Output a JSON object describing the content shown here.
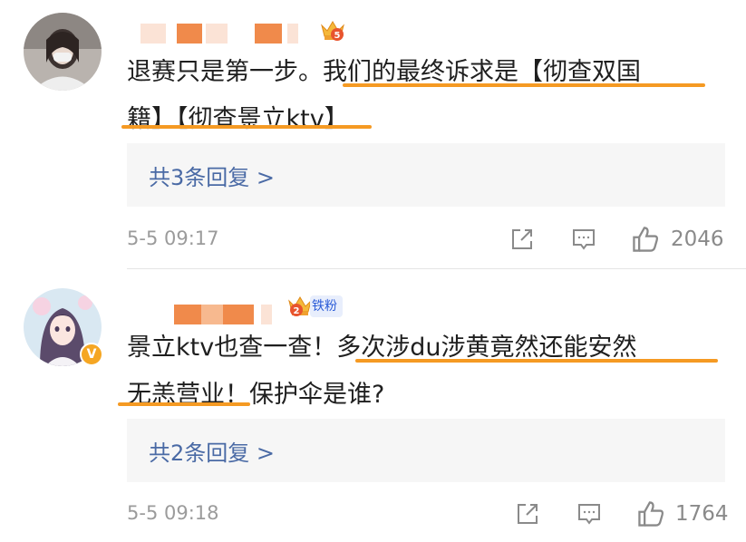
{
  "comments": [
    {
      "avatar": "avatar-photo-woman-mask",
      "name_badge": "crown-level-5",
      "crown_level": "5",
      "text_plain": "退赛只是第一步。",
      "text_underlined_1": "我们的最终诉求是【彻查双国",
      "text_underlined_2": "籍】【彻查景立ktv】",
      "replies_label": "共3条回复 >",
      "timestamp": "5-5 09:17",
      "like_count": "2046"
    },
    {
      "avatar": "avatar-anime-girl",
      "name_badge": "crown-level-2",
      "crown_level": "2",
      "fan_badge": "铁粉",
      "text_plain": "景立ktv也查一查！",
      "text_underlined_1": "多次涉du涉黄竟然还能安然",
      "text_underlined_2": "无恙营业！",
      "text_plain_2": "保护伞是谁?",
      "replies_label": "共2条回复 >",
      "timestamp": "5-5 09:18",
      "like_count": "1764"
    }
  ],
  "colors": {
    "underline": "#f59a23",
    "reply_link": "#4a6aa5",
    "meta_gray": "#9b9b9b",
    "replies_bg": "#f6f6f6",
    "name_block_orange": "#f08a4b"
  },
  "icons": {
    "repost": "share-icon",
    "comment": "comment-icon",
    "like": "thumbs-up-icon"
  }
}
